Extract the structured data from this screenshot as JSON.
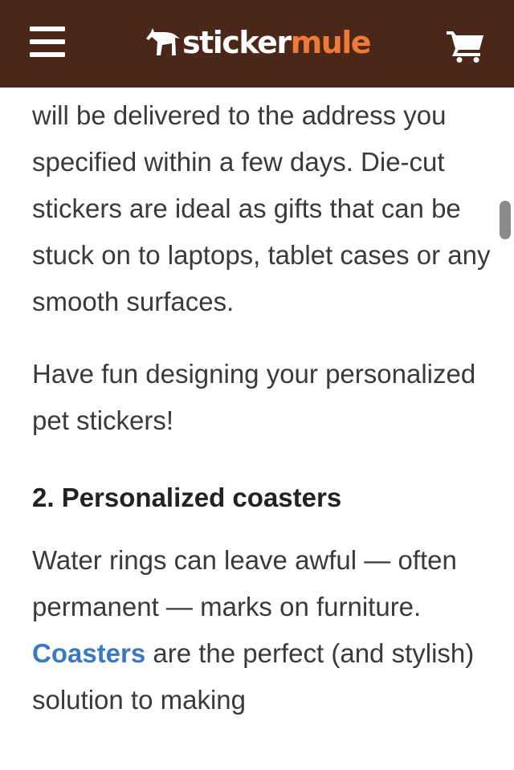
{
  "header": {
    "logo_part1": "sticker",
    "logo_part2": "mule",
    "menu_icon": "hamburger-icon",
    "cart_icon": "shopping-cart-icon",
    "background": "#4a2718",
    "accent": "#ee7a3a"
  },
  "article": {
    "para1": "will be delivered to the address you specified within a few days. Die-cut stickers are ideal as gifts that can be stuck on to laptops, tablet cases or any smooth surfaces.",
    "para2": "Have fun designing your personalized pet stickers!",
    "heading2": "2. Personalized coasters",
    "para3_before": "Water rings can leave awful — often permanent — marks on furniture. ",
    "para3_link": "Coasters",
    "para3_after": " are the perfect (and stylish) solution to making",
    "link_color": "#3a79c0"
  }
}
